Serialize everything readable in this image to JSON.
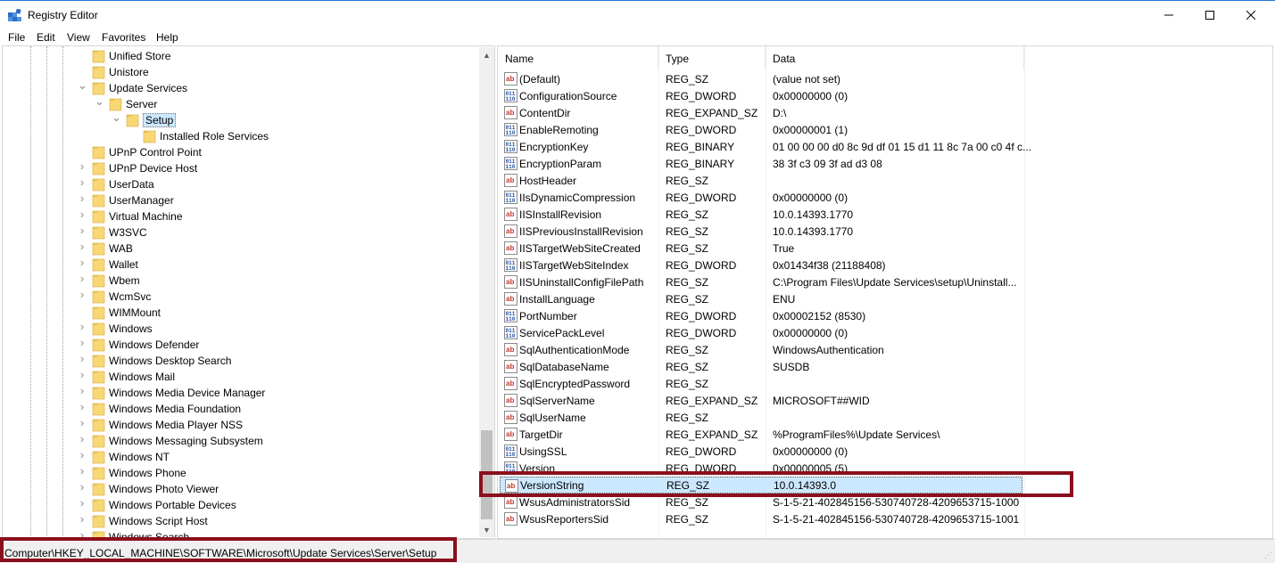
{
  "window": {
    "title": "Registry Editor",
    "minimize_icon": "minimize-icon",
    "maximize_icon": "maximize-icon",
    "close_icon": "close-icon"
  },
  "menu": {
    "file": "File",
    "edit": "Edit",
    "view": "View",
    "favorites": "Favorites",
    "help": "Help"
  },
  "tree": {
    "items": [
      {
        "label": "Unified Store",
        "expander": "none"
      },
      {
        "label": "Unistore",
        "expander": "none"
      },
      {
        "label": "Update Services",
        "expander": "expanded"
      },
      {
        "label": "Server",
        "expander": "expanded"
      },
      {
        "label": "Setup",
        "expander": "expanded",
        "selected": true
      },
      {
        "label": "Installed Role Services",
        "expander": "none"
      },
      {
        "label": "UPnP Control Point",
        "expander": "none"
      },
      {
        "label": "UPnP Device Host",
        "expander": "collapsed"
      },
      {
        "label": "UserData",
        "expander": "collapsed"
      },
      {
        "label": "UserManager",
        "expander": "collapsed"
      },
      {
        "label": "Virtual Machine",
        "expander": "collapsed"
      },
      {
        "label": "W3SVC",
        "expander": "collapsed"
      },
      {
        "label": "WAB",
        "expander": "collapsed"
      },
      {
        "label": "Wallet",
        "expander": "collapsed"
      },
      {
        "label": "Wbem",
        "expander": "collapsed"
      },
      {
        "label": "WcmSvc",
        "expander": "collapsed"
      },
      {
        "label": "WIMMount",
        "expander": "none"
      },
      {
        "label": "Windows",
        "expander": "collapsed"
      },
      {
        "label": "Windows Defender",
        "expander": "collapsed"
      },
      {
        "label": "Windows Desktop Search",
        "expander": "collapsed"
      },
      {
        "label": "Windows Mail",
        "expander": "collapsed"
      },
      {
        "label": "Windows Media Device Manager",
        "expander": "collapsed"
      },
      {
        "label": "Windows Media Foundation",
        "expander": "collapsed"
      },
      {
        "label": "Windows Media Player NSS",
        "expander": "collapsed"
      },
      {
        "label": "Windows Messaging Subsystem",
        "expander": "collapsed"
      },
      {
        "label": "Windows NT",
        "expander": "collapsed"
      },
      {
        "label": "Windows Phone",
        "expander": "collapsed"
      },
      {
        "label": "Windows Photo Viewer",
        "expander": "collapsed"
      },
      {
        "label": "Windows Portable Devices",
        "expander": "collapsed"
      },
      {
        "label": "Windows Script Host",
        "expander": "collapsed"
      },
      {
        "label": "Windows Search",
        "expander": "collapsed"
      }
    ]
  },
  "list": {
    "columns": {
      "name": "Name",
      "type": "Type",
      "data": "Data"
    },
    "rows": [
      {
        "name": "(Default)",
        "type": "REG_SZ",
        "data": "(value not set)",
        "icon": "string-value-icon"
      },
      {
        "name": "ConfigurationSource",
        "type": "REG_DWORD",
        "data": "0x00000000 (0)",
        "icon": "binary-value-icon"
      },
      {
        "name": "ContentDir",
        "type": "REG_EXPAND_SZ",
        "data": "D:\\",
        "icon": "string-value-icon"
      },
      {
        "name": "EnableRemoting",
        "type": "REG_DWORD",
        "data": "0x00000001 (1)",
        "icon": "binary-value-icon"
      },
      {
        "name": "EncryptionKey",
        "type": "REG_BINARY",
        "data": "01 00 00 00 d0 8c 9d df 01 15 d1 11 8c 7a 00 c0 4f c...",
        "icon": "binary-value-icon"
      },
      {
        "name": "EncryptionParam",
        "type": "REG_BINARY",
        "data": "38 3f c3 09 3f ad d3 08",
        "icon": "binary-value-icon"
      },
      {
        "name": "HostHeader",
        "type": "REG_SZ",
        "data": "",
        "icon": "string-value-icon"
      },
      {
        "name": "IIsDynamicCompression",
        "type": "REG_DWORD",
        "data": "0x00000000 (0)",
        "icon": "binary-value-icon"
      },
      {
        "name": "IISInstallRevision",
        "type": "REG_SZ",
        "data": "10.0.14393.1770",
        "icon": "string-value-icon"
      },
      {
        "name": "IISPreviousInstallRevision",
        "type": "REG_SZ",
        "data": "10.0.14393.1770",
        "icon": "string-value-icon"
      },
      {
        "name": "IISTargetWebSiteCreated",
        "type": "REG_SZ",
        "data": "True",
        "icon": "string-value-icon"
      },
      {
        "name": "IISTargetWebSiteIndex",
        "type": "REG_DWORD",
        "data": "0x01434f38 (21188408)",
        "icon": "binary-value-icon"
      },
      {
        "name": "IISUninstallConfigFilePath",
        "type": "REG_SZ",
        "data": "C:\\Program Files\\Update Services\\setup\\Uninstall...",
        "icon": "string-value-icon"
      },
      {
        "name": "InstallLanguage",
        "type": "REG_SZ",
        "data": "ENU",
        "icon": "string-value-icon"
      },
      {
        "name": "PortNumber",
        "type": "REG_DWORD",
        "data": "0x00002152 (8530)",
        "icon": "binary-value-icon"
      },
      {
        "name": "ServicePackLevel",
        "type": "REG_DWORD",
        "data": "0x00000000 (0)",
        "icon": "binary-value-icon"
      },
      {
        "name": "SqlAuthenticationMode",
        "type": "REG_SZ",
        "data": "WindowsAuthentication",
        "icon": "string-value-icon"
      },
      {
        "name": "SqlDatabaseName",
        "type": "REG_SZ",
        "data": "SUSDB",
        "icon": "string-value-icon"
      },
      {
        "name": "SqlEncryptedPassword",
        "type": "REG_SZ",
        "data": "",
        "icon": "string-value-icon"
      },
      {
        "name": "SqlServerName",
        "type": "REG_EXPAND_SZ",
        "data": "MICROSOFT##WID",
        "icon": "string-value-icon"
      },
      {
        "name": "SqlUserName",
        "type": "REG_SZ",
        "data": "",
        "icon": "string-value-icon"
      },
      {
        "name": "TargetDir",
        "type": "REG_EXPAND_SZ",
        "data": "%ProgramFiles%\\Update Services\\",
        "icon": "string-value-icon"
      },
      {
        "name": "UsingSSL",
        "type": "REG_DWORD",
        "data": "0x00000000 (0)",
        "icon": "binary-value-icon"
      },
      {
        "name": "Version",
        "type": "REG_DWORD",
        "data": "0x00000005 (5)",
        "icon": "binary-value-icon"
      },
      {
        "name": "VersionString",
        "type": "REG_SZ",
        "data": "10.0.14393.0",
        "icon": "string-value-icon",
        "selected": true
      },
      {
        "name": "WsusAdministratorsSid",
        "type": "REG_SZ",
        "data": "S-1-5-21-402845156-530740728-4209653715-1000",
        "icon": "string-value-icon"
      },
      {
        "name": "WsusReportersSid",
        "type": "REG_SZ",
        "data": "S-1-5-21-402845156-530740728-4209653715-1001",
        "icon": "string-value-icon"
      }
    ]
  },
  "status": {
    "path": "Computer\\HKEY_LOCAL_MACHINE\\SOFTWARE\\Microsoft\\Update Services\\Server\\Setup"
  },
  "colors": {
    "annotation_box": "#8b0f1c",
    "selection": "#cce8ff",
    "folder": "#f8d775"
  }
}
